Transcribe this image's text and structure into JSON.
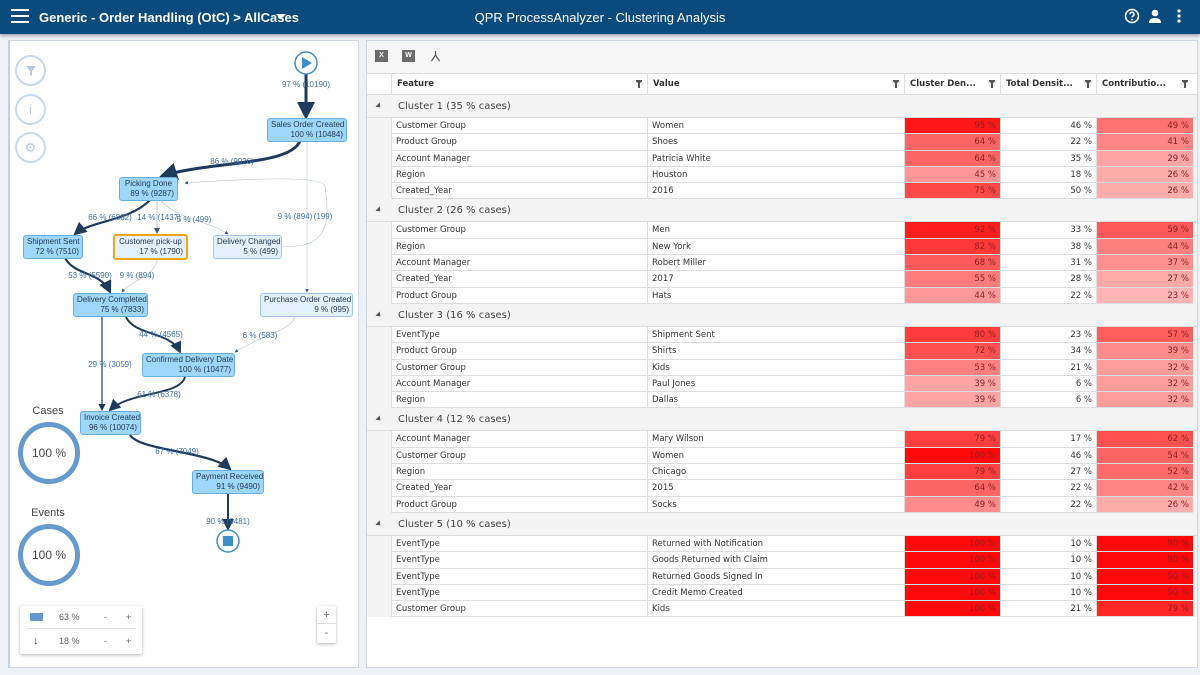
{
  "header": {
    "breadcrumb": "Generic - Order Handling (OtC) > AllCases",
    "title": "QPR ProcessAnalyzer - Clustering Analysis",
    "icons": [
      "menu-icon",
      "help-icon",
      "user-icon",
      "more-vertical-icon"
    ]
  },
  "colors": {
    "header": "#0b4a7d",
    "node": "#9fd6fb",
    "selected": "#f2a51c",
    "heat": "#ff0000"
  },
  "map": {
    "nodes": [
      {
        "id": "soc",
        "name": "Sales Order Created",
        "stat": "100 % (10484)"
      },
      {
        "id": "pd",
        "name": "Picking Done",
        "stat": "89 % (9287)"
      },
      {
        "id": "ss",
        "name": "Shipment Sent",
        "stat": "72 % (7510)"
      },
      {
        "id": "cp",
        "name": "Customer pick-up",
        "stat": "17 % (1790)"
      },
      {
        "id": "dch",
        "name": "Delivery Changed",
        "stat": "5 % (499)"
      },
      {
        "id": "dc",
        "name": "Delivery Completed",
        "stat": "75 % (7833)"
      },
      {
        "id": "poc",
        "name": "Purchase Order Created",
        "stat": "9 % (995)"
      },
      {
        "id": "cdd",
        "name": "Confirmed Delivery Date",
        "stat": "100 % (10477)"
      },
      {
        "id": "ic",
        "name": "Invoice Created",
        "stat": "96 % (10074)"
      },
      {
        "id": "pr",
        "name": "Payment Received",
        "stat": "91 % (9490)"
      }
    ],
    "edges": [
      "97 % (10190)",
      "86 % (9026)",
      "66 % (6882)",
      "14 % (1437)",
      "5 % (499)",
      "9 % (894)",
      "(199)",
      "53 % (5590)",
      "9 % (894)",
      "44 % (4565)",
      "6 % (583)",
      "29 % (3059)",
      "61 % (6378)",
      "67 % (7049)",
      "90 % (9481)"
    ],
    "cases_label": "Cases",
    "cases_value": "100 %",
    "events_label": "Events",
    "events_value": "100 %",
    "activity_slider": "63 %",
    "flow_slider": "18 %",
    "minus": "-",
    "plus": "+"
  },
  "table": {
    "columns": [
      "Feature",
      "Value",
      "Cluster Den...",
      "Total Densit...",
      "Contributio..."
    ],
    "clusters": [
      {
        "label": "Cluster 1 (35 % cases)",
        "rows": [
          [
            "Customer Group",
            "Women",
            95,
            46,
            49
          ],
          [
            "Product Group",
            "Shoes",
            64,
            22,
            41
          ],
          [
            "Account Manager",
            "Patricia White",
            64,
            35,
            29
          ],
          [
            "Region",
            "Houston",
            45,
            18,
            26
          ],
          [
            "Created_Year",
            "2016",
            75,
            50,
            26
          ]
        ]
      },
      {
        "label": "Cluster 2 (26 % cases)",
        "rows": [
          [
            "Customer Group",
            "Men",
            92,
            33,
            59
          ],
          [
            "Region",
            "New York",
            82,
            38,
            44
          ],
          [
            "Account Manager",
            "Robert Miller",
            68,
            31,
            37
          ],
          [
            "Created_Year",
            "2017",
            55,
            28,
            27
          ],
          [
            "Product Group",
            "Hats",
            44,
            22,
            23
          ]
        ]
      },
      {
        "label": "Cluster 3 (16 % cases)",
        "rows": [
          [
            "EventType",
            "Shipment Sent",
            80,
            23,
            57
          ],
          [
            "Product Group",
            "Shirts",
            72,
            34,
            39
          ],
          [
            "Customer Group",
            "Kids",
            53,
            21,
            32
          ],
          [
            "Account Manager",
            "Paul Jones",
            39,
            6,
            32
          ],
          [
            "Region",
            "Dallas",
            39,
            6,
            32
          ]
        ]
      },
      {
        "label": "Cluster 4 (12 % cases)",
        "rows": [
          [
            "Account Manager",
            "Mary Wilson",
            79,
            17,
            62
          ],
          [
            "Customer Group",
            "Women",
            100,
            46,
            54
          ],
          [
            "Region",
            "Chicago",
            79,
            27,
            52
          ],
          [
            "Created_Year",
            "2015",
            64,
            22,
            42
          ],
          [
            "Product Group",
            "Socks",
            49,
            22,
            26
          ]
        ]
      },
      {
        "label": "Cluster 5 (10 % cases)",
        "rows": [
          [
            "EventType",
            "Returned with Notification",
            100,
            10,
            90
          ],
          [
            "EventType",
            "Goods Returned with Claim",
            100,
            10,
            90
          ],
          [
            "EventType",
            "Returned Goods Signed In",
            100,
            10,
            90
          ],
          [
            "EventType",
            "Credit Memo Created",
            100,
            10,
            90
          ],
          [
            "Customer Group",
            "Kids",
            100,
            21,
            79
          ]
        ]
      }
    ]
  }
}
